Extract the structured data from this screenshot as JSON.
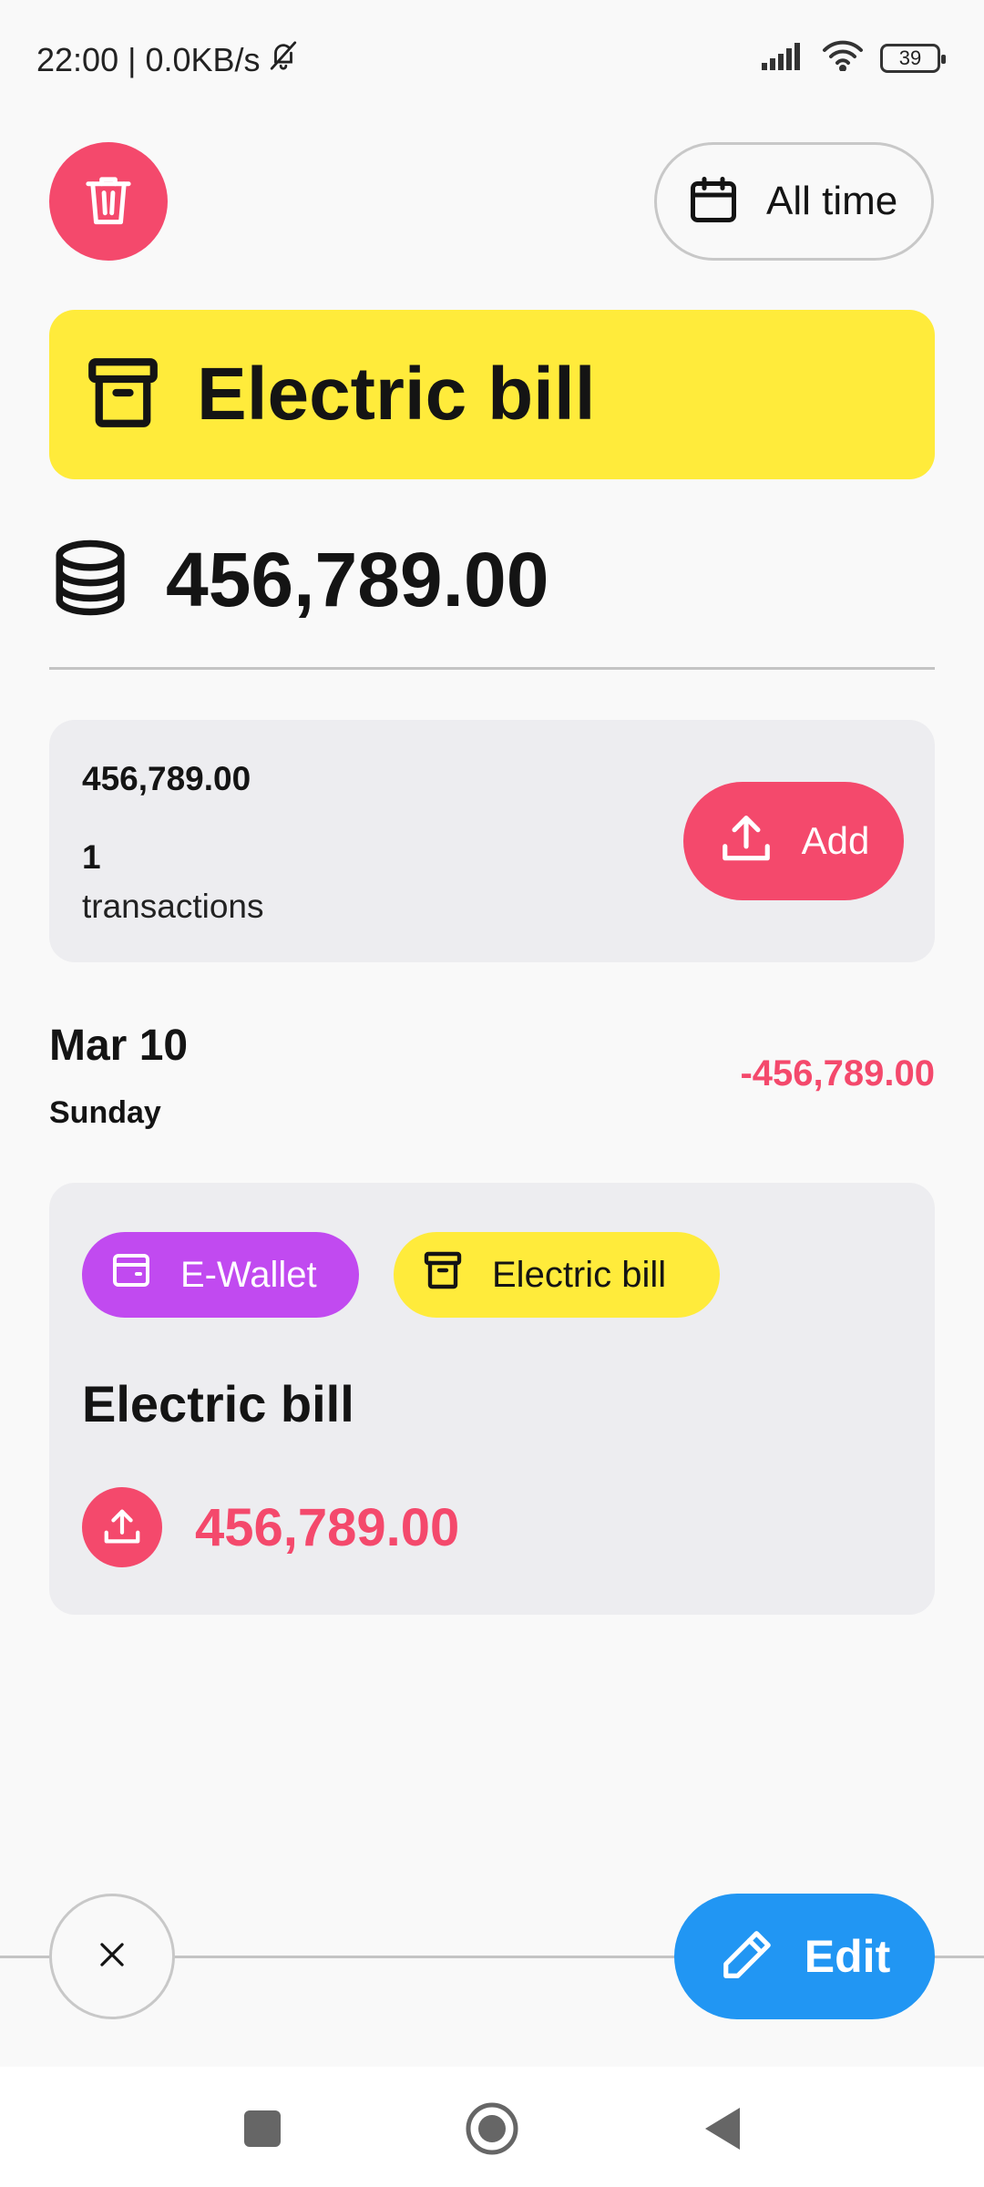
{
  "status_bar": {
    "time_network": "22:00 | 0.0KB/s",
    "battery": "39",
    "icons": [
      "bell-off-icon",
      "signal-icon",
      "wifi-icon",
      "battery-icon"
    ]
  },
  "header": {
    "delete_icon": "trash-icon",
    "date_range_icon": "calendar-icon",
    "date_range_label": "All time"
  },
  "category": {
    "icon": "archive-box-icon",
    "title": "Electric bill",
    "color": "#ffeb3b"
  },
  "total": {
    "icon": "coins-stack-icon",
    "amount": "456,789.00"
  },
  "summary": {
    "amount": "456,789.00",
    "count": "1",
    "count_label": "transactions",
    "add_label": "Add",
    "add_icon": "upload-icon"
  },
  "day": {
    "date": "Mar 10",
    "weekday": "Sunday",
    "total": "-456,789.00"
  },
  "transaction": {
    "wallet_label": "E-Wallet",
    "wallet_color": "#c14af0",
    "category_label": "Electric bill",
    "category_color": "#ffeb3b",
    "title": "Electric bill",
    "amount": "456,789.00",
    "amount_color": "#f4496c"
  },
  "actions": {
    "close_icon": "close-icon",
    "edit_label": "Edit",
    "edit_icon": "pencil-icon",
    "edit_color": "#2196f3"
  },
  "nav": {
    "items": [
      "recents-square-icon",
      "home-circle-icon",
      "back-triangle-icon"
    ]
  },
  "colors": {
    "accent_red": "#f4496c",
    "accent_yellow": "#ffeb3b",
    "accent_blue": "#2196f3",
    "accent_purple": "#c14af0"
  }
}
